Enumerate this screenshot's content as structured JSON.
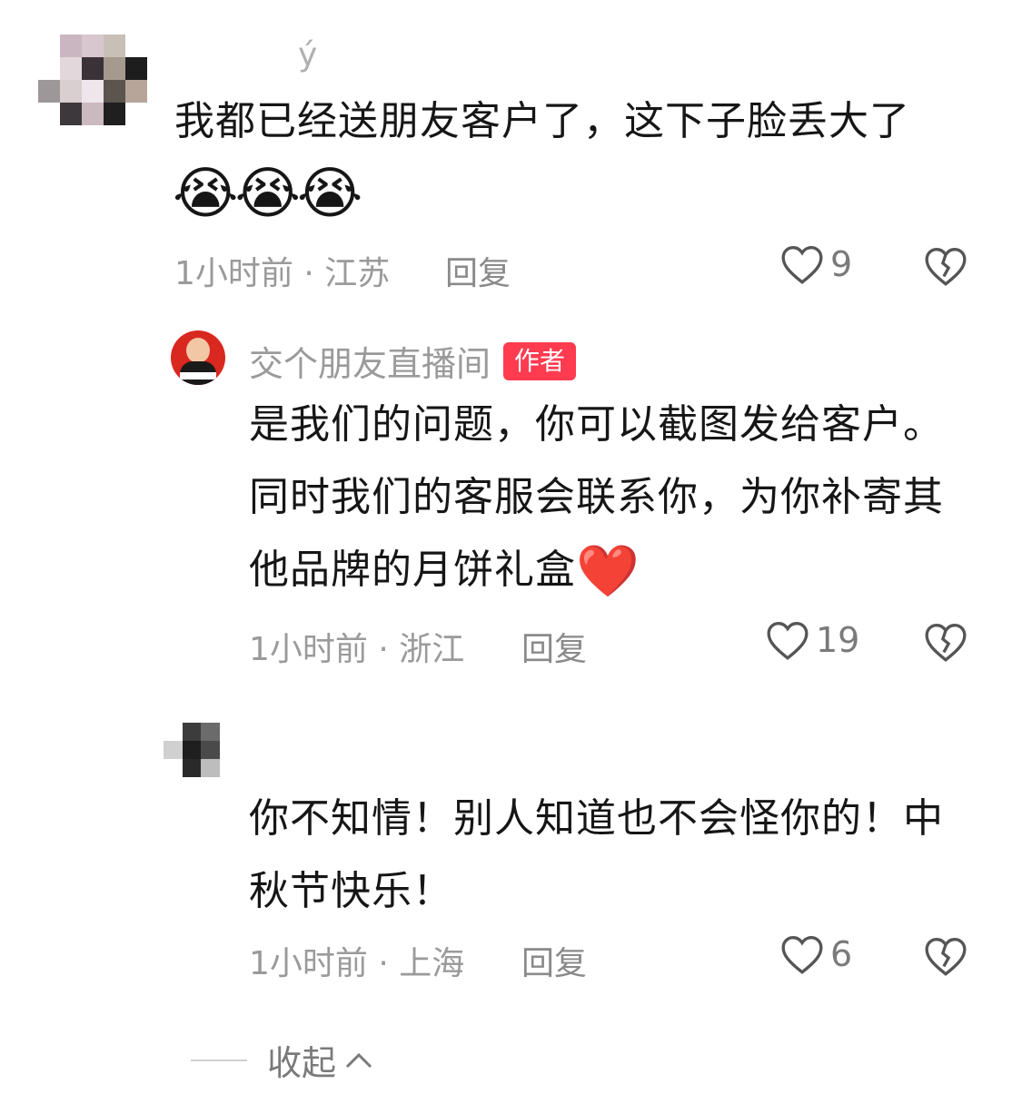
{
  "comment1": {
    "username_fragment": "ý",
    "text_line1": "我都已经送朋友客户了，这下子脸丢大了",
    "emoji": "😭😭😭",
    "time": "1小时前",
    "region": "江苏",
    "reply_label": "回复",
    "likes": "9"
  },
  "reply1": {
    "username": "交个朋友直播间",
    "badge": "作者",
    "text_line1": "是我们的问题，你可以截图发给客户。",
    "text_line2": "同时我们的客服会联系你，为你补寄其",
    "text_line3": "他品牌的月饼礼盒",
    "emoji": "❤️",
    "time": "1小时前",
    "region": "浙江",
    "reply_label": "回复",
    "likes": "19"
  },
  "reply2": {
    "text_line1": "你不知情！别人知道也不会怪你的！中",
    "text_line2": "秋节快乐！",
    "time": "1小时前",
    "region": "上海",
    "reply_label": "回复",
    "likes": "6"
  },
  "collapse": {
    "label": "收起"
  },
  "icons": {
    "like": "heart-outline-icon",
    "dislike": "broken-heart-icon",
    "collapse": "chevron-up-icon"
  },
  "colors": {
    "badge": "#ff3b50",
    "meta": "#9a9a9a",
    "text": "#161616"
  }
}
